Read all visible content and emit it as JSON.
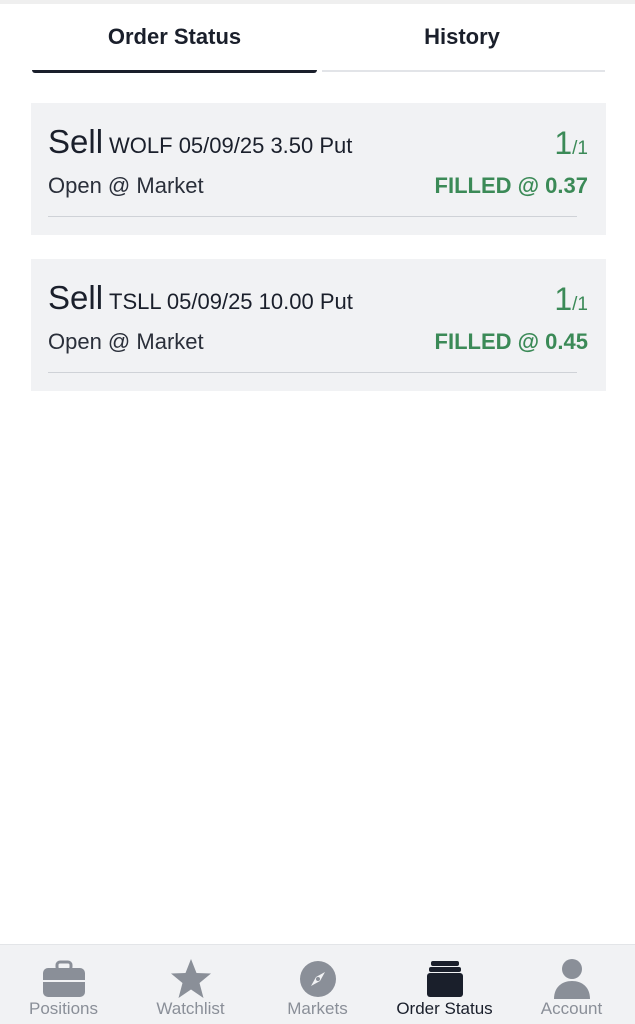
{
  "tabs": {
    "order_status": "Order Status",
    "history": "History"
  },
  "orders": [
    {
      "side": "Sell",
      "description": "WOLF 05/09/25 3.50 Put",
      "qty_filled": "1",
      "qty_total": "/1",
      "type": "Open @ Market",
      "status": "FILLED @ 0.37"
    },
    {
      "side": "Sell",
      "description": "TSLL 05/09/25 10.00 Put",
      "qty_filled": "1",
      "qty_total": "/1",
      "type": "Open @ Market",
      "status": "FILLED @ 0.45"
    }
  ],
  "nav": {
    "positions": {
      "label": "Positions",
      "icon": "briefcase-icon"
    },
    "watchlist": {
      "label": "Watchlist",
      "icon": "star-icon"
    },
    "markets": {
      "label": "Markets",
      "icon": "compass-icon"
    },
    "order_status": {
      "label": "Order Status",
      "icon": "stacked-cards-icon"
    },
    "account": {
      "label": "Account",
      "icon": "person-icon"
    }
  },
  "colors": {
    "filled_green": "#3b8a57",
    "card_bg": "#f1f2f4",
    "nav_inactive": "#8a8f98",
    "nav_active": "#1a1f2b",
    "text_dark": "#1a1f2b"
  }
}
